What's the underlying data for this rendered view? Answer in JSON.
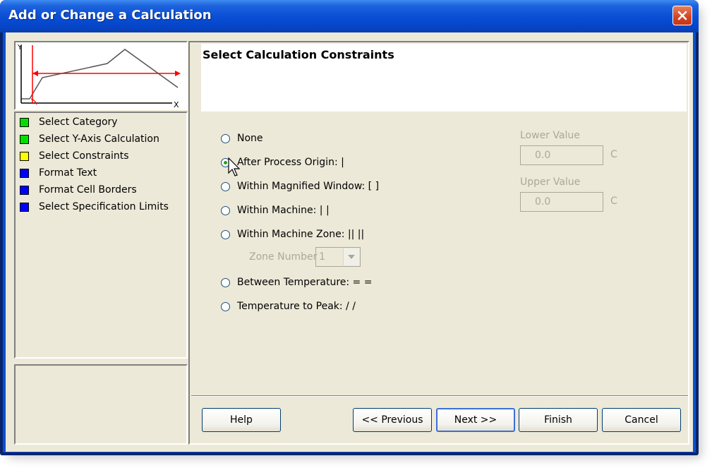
{
  "window": {
    "title": "Add or Change a Calculation"
  },
  "thumbnail": {
    "y_label": "Y",
    "x_label": "X"
  },
  "steps": [
    {
      "label": "Select Category",
      "color": "#00e000"
    },
    {
      "label": "Select Y-Axis Calculation",
      "color": "#00e000"
    },
    {
      "label": "Select Constraints",
      "color": "#ffff00"
    },
    {
      "label": "Format Text",
      "color": "#0000ff"
    },
    {
      "label": "Format Cell Borders",
      "color": "#0000ff"
    },
    {
      "label": "Select Specification Limits",
      "color": "#0000ff"
    }
  ],
  "header": {
    "title": "Select Calculation Constraints"
  },
  "options": [
    {
      "label": "None",
      "checked": false
    },
    {
      "label": "After Process Origin: |",
      "checked": true
    },
    {
      "label": "Within Magnified Window: [  ]",
      "checked": false
    },
    {
      "label": "Within Machine: |  |",
      "checked": false
    },
    {
      "label": "Within Machine Zone: ||  ||",
      "checked": false
    },
    {
      "label": "Between Temperature: =  =",
      "checked": false
    },
    {
      "label": "Temperature to Peak: /  /",
      "checked": false
    }
  ],
  "zone": {
    "label": "Zone Number",
    "value": "1"
  },
  "lower": {
    "label": "Lower Value",
    "value": "0.0",
    "unit": "C"
  },
  "upper": {
    "label": "Upper Value",
    "value": "0.0",
    "unit": "C"
  },
  "buttons": {
    "help": "Help",
    "previous": "<< Previous",
    "next": "Next >>",
    "finish": "Finish",
    "cancel": "Cancel"
  }
}
